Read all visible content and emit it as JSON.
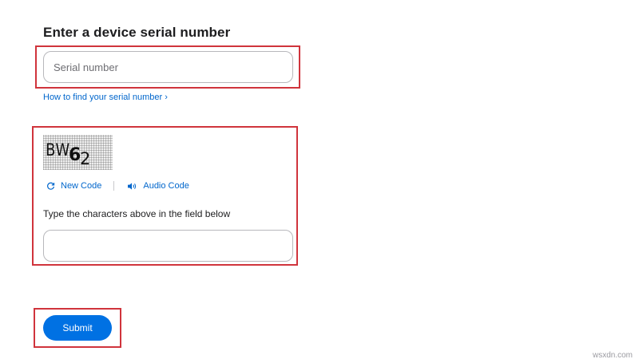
{
  "form": {
    "heading": "Enter a device serial number",
    "serial_field": {
      "placeholder": "Serial number",
      "value": ""
    },
    "find_serial_link": "How to find your serial number ›",
    "captcha": {
      "image_text": [
        "B",
        "W",
        "6",
        "2"
      ],
      "new_code_label": "New Code",
      "audio_code_label": "Audio Code",
      "instruction": "Type the characters above in the field below",
      "input_value": ""
    },
    "submit_label": "Submit"
  },
  "colors": {
    "accent": "#0066cc",
    "button": "#0071e3",
    "highlight": "#d0343c"
  },
  "watermark": "wsxdn.com"
}
